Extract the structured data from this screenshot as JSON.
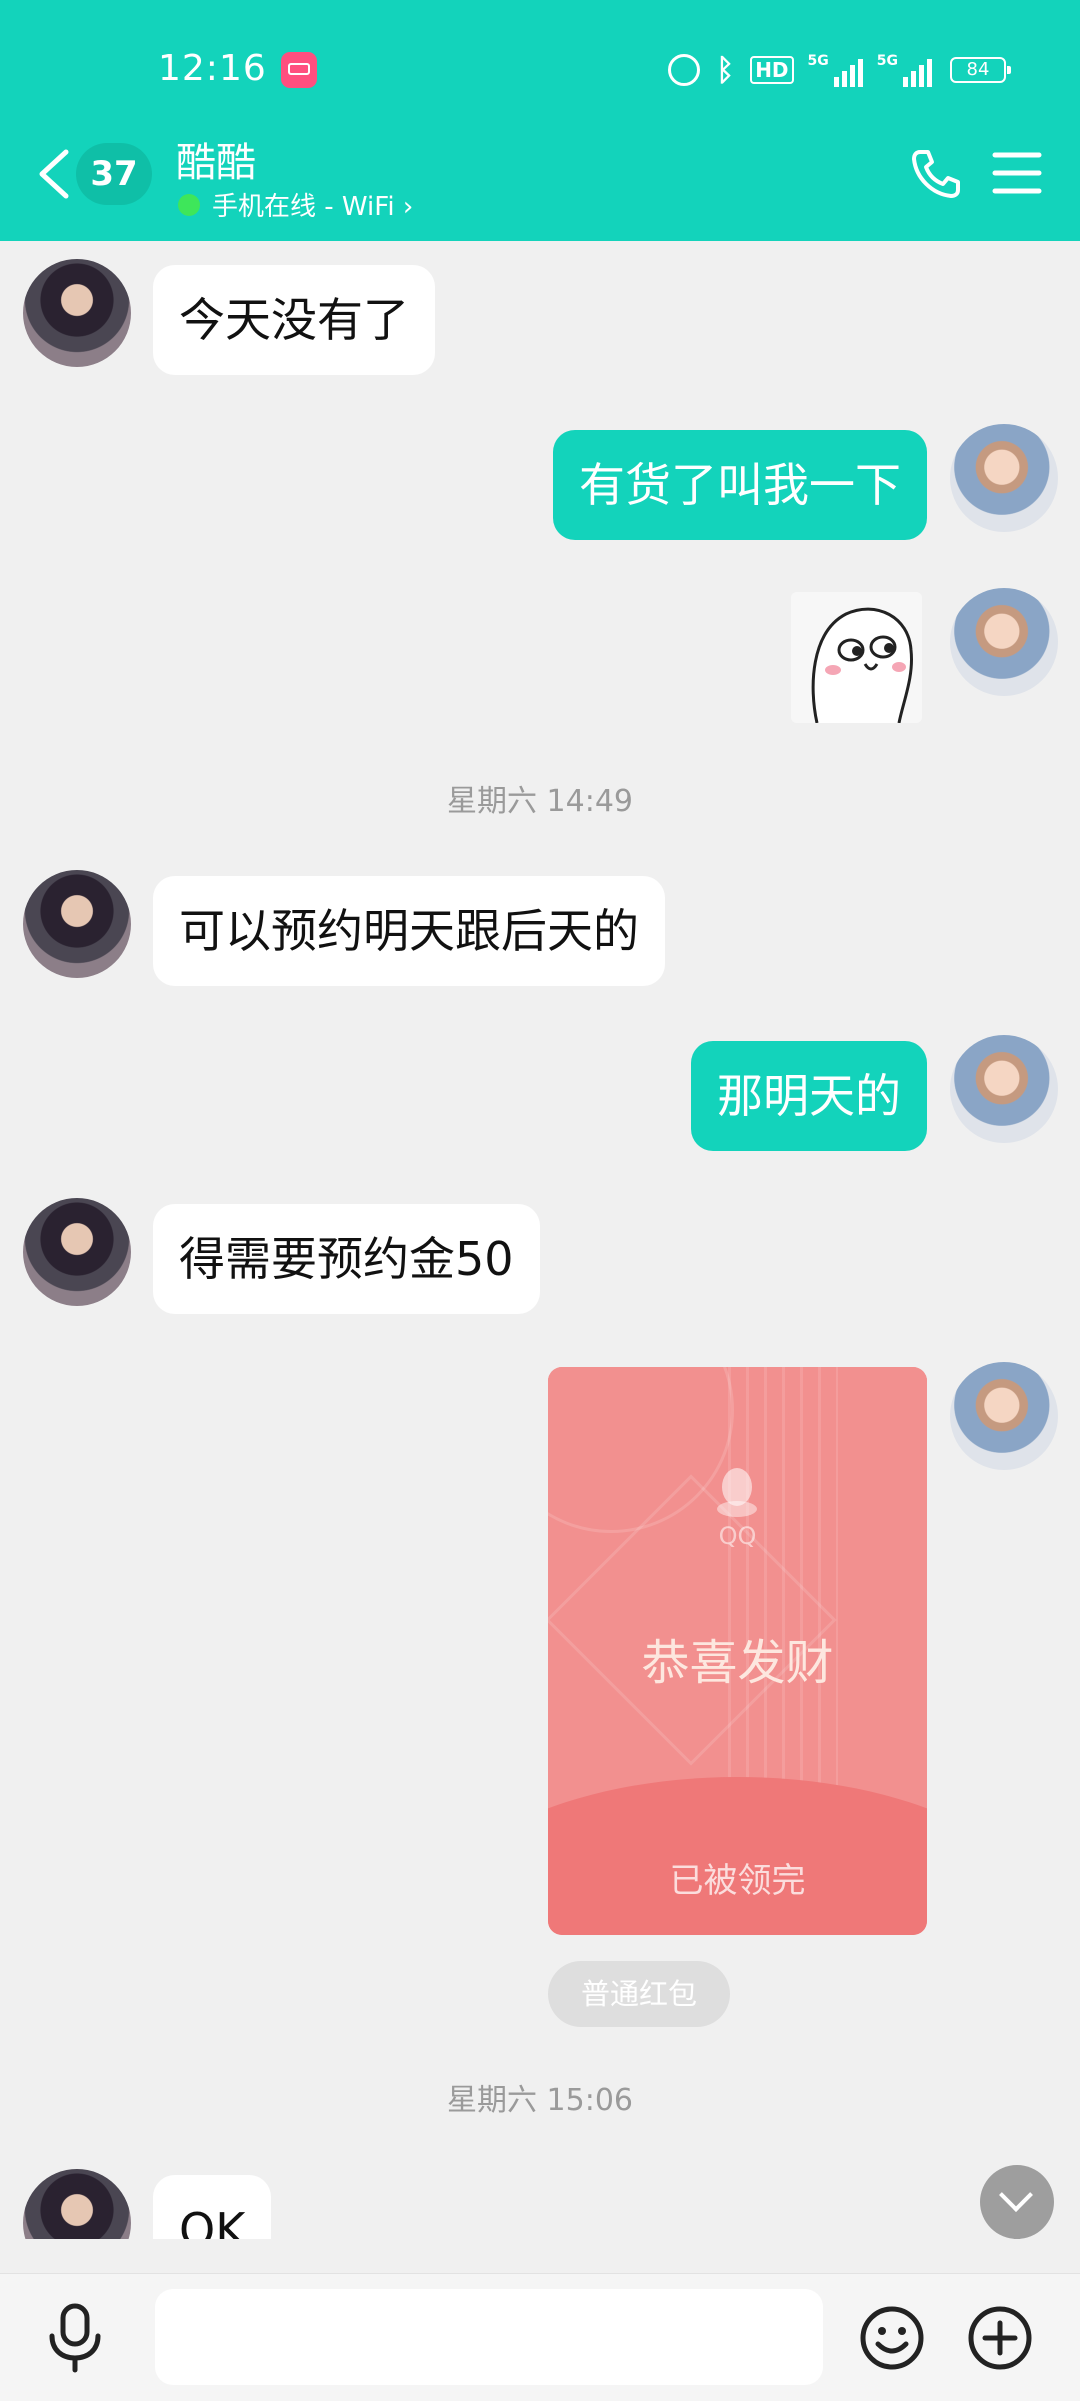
{
  "status_bar": {
    "time": "12:16",
    "battery": "84",
    "hd_label": "HD",
    "net1": "5G",
    "net2": "5G"
  },
  "header": {
    "unread_count": "37",
    "contact_name": "酷酷",
    "status_text": "手机在线 - WiFi ›"
  },
  "messages": [
    {
      "side": "in",
      "type": "text",
      "text": "今天没有了"
    },
    {
      "side": "out",
      "type": "text",
      "text": "有货了叫我一下"
    },
    {
      "side": "out",
      "type": "sticker",
      "icon": "smiling-blob-sticker"
    },
    {
      "type": "timestamp",
      "text": "星期六 14:49"
    },
    {
      "side": "in",
      "type": "text",
      "text": "可以预约明天跟后天的"
    },
    {
      "side": "out",
      "type": "text",
      "text": "那明天的"
    },
    {
      "side": "in",
      "type": "text",
      "text": "得需要预约金50"
    },
    {
      "side": "out",
      "type": "red_packet",
      "brand": "QQ",
      "greeting": "恭喜发财",
      "status": "已被领完",
      "tag": "普通红包"
    },
    {
      "type": "timestamp",
      "text": "星期六 15:06"
    },
    {
      "side": "in",
      "type": "text",
      "text": "OK"
    }
  ],
  "input": {
    "value": "",
    "placeholder": ""
  },
  "colors": {
    "accent": "#13d3bb",
    "red_packet": "#f08d8c",
    "background": "#f0f0f0"
  }
}
